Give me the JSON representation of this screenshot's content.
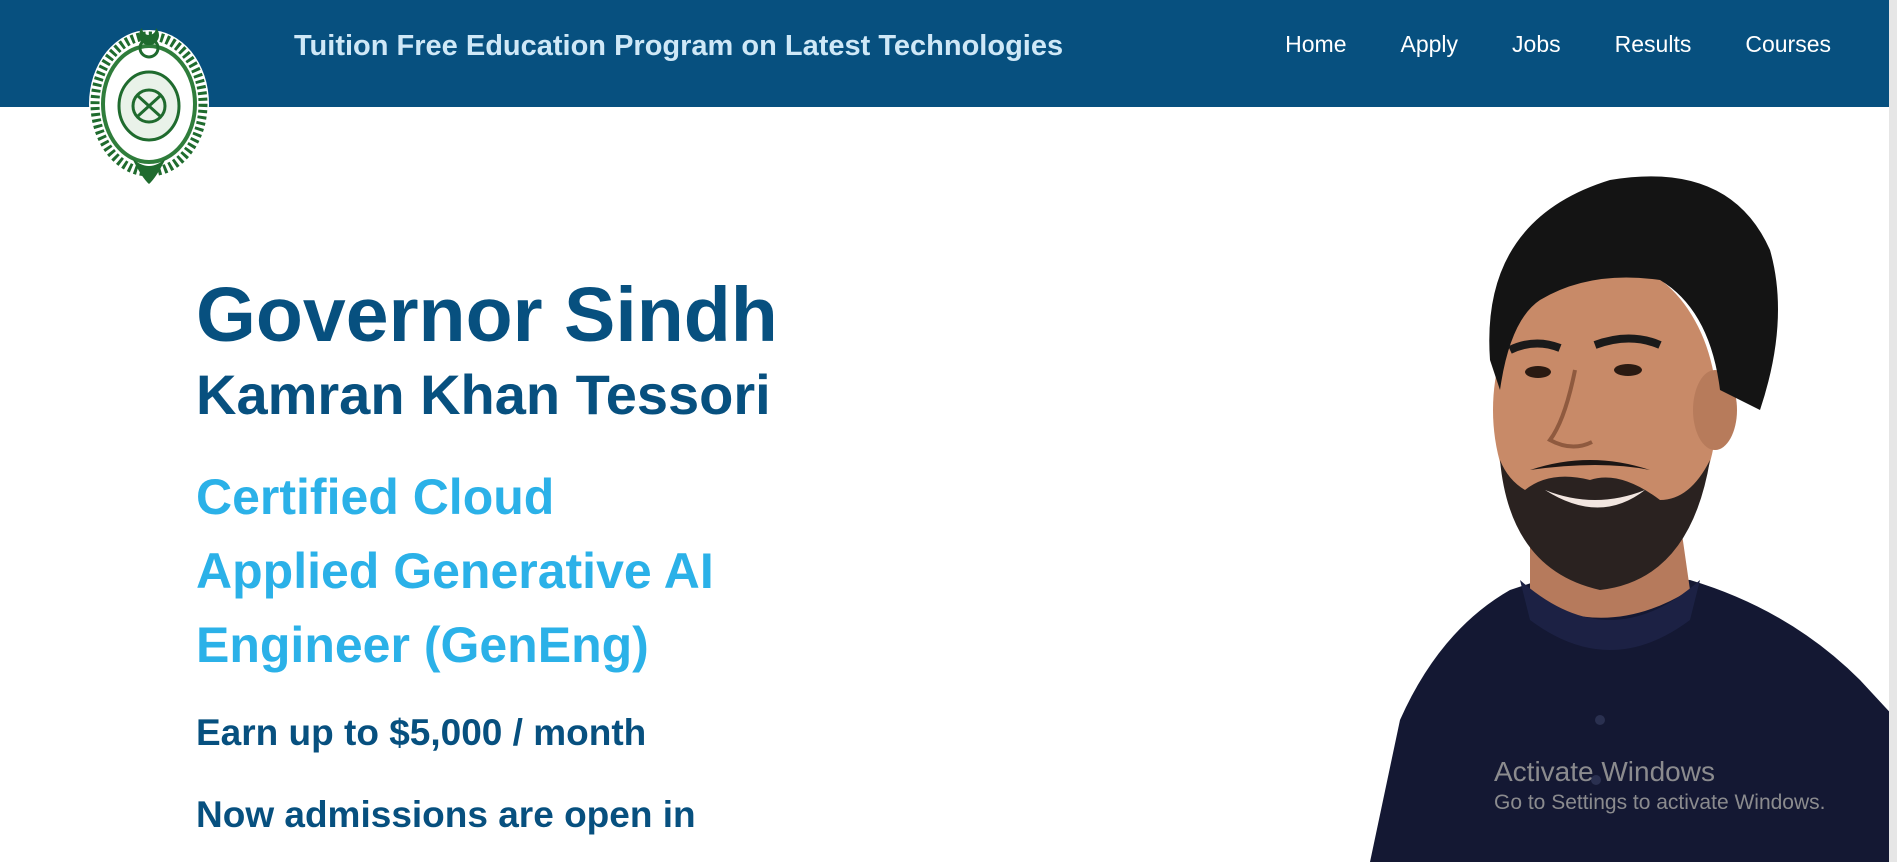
{
  "header": {
    "title": "Tuition Free Education Program on Latest Technologies",
    "nav": [
      {
        "label": "Home"
      },
      {
        "label": "Apply"
      },
      {
        "label": "Jobs"
      },
      {
        "label": "Results"
      },
      {
        "label": "Courses"
      }
    ]
  },
  "hero": {
    "title": "Governor Sindh",
    "name": "Kamran Khan Tessori",
    "program_lines": [
      "Certified Cloud",
      "Applied Generative AI",
      "Engineer (GenEng)"
    ],
    "earn": "Earn up to $5,000 / month",
    "admissions": "Now admissions are open in"
  },
  "watermark": {
    "title": "Activate Windows",
    "subtitle": "Go to Settings to activate Windows."
  },
  "colors": {
    "nav_bg": "#07507f",
    "title_text": "#cfe8f7",
    "primary_dark": "#07507f",
    "accent_blue": "#2bb1e8"
  }
}
